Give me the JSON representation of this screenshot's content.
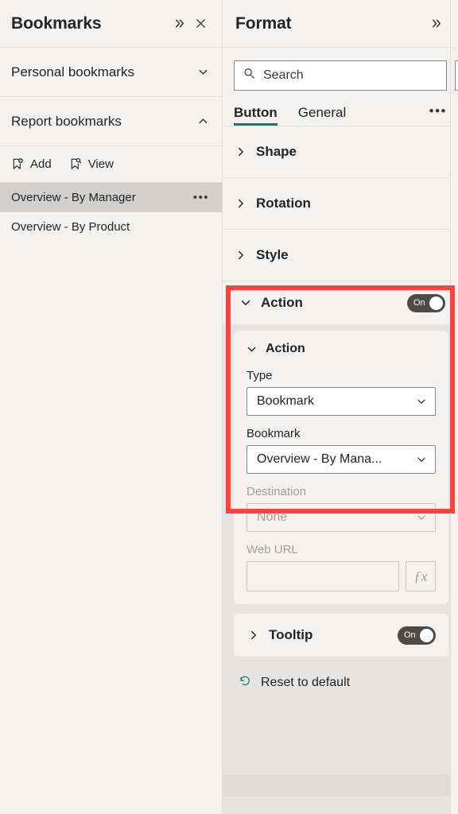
{
  "bookmarks_pane": {
    "title": "Bookmarks",
    "expand_icon": "double-chevron-right-icon",
    "close_icon": "close-icon",
    "sections": [
      {
        "label": "Personal bookmarks",
        "state": "collapsed",
        "chevron": "chevron-down-icon"
      },
      {
        "label": "Report bookmarks",
        "state": "expanded",
        "chevron": "chevron-up-icon"
      }
    ],
    "toolbar": [
      {
        "label": "Add",
        "icon": "bookmark-add-icon"
      },
      {
        "label": "View",
        "icon": "bookmark-view-icon"
      }
    ],
    "list": [
      {
        "label": "Overview - By Manager",
        "selected": true,
        "overflow": "•••"
      },
      {
        "label": "Overview - By Product",
        "selected": false,
        "overflow": ""
      }
    ]
  },
  "format_pane": {
    "title": "Format",
    "expand_icon": "double-chevron-right-icon",
    "search": {
      "placeholder": "Search",
      "value": "",
      "icon": "search-icon"
    },
    "tabs": [
      {
        "label": "Button",
        "active": true
      },
      {
        "label": "General",
        "active": false
      }
    ],
    "tabs_overflow": "•••",
    "accordions": [
      {
        "label": "Shape",
        "state": "collapsed"
      },
      {
        "label": "Rotation",
        "state": "collapsed"
      },
      {
        "label": "Style",
        "state": "collapsed"
      }
    ],
    "action_section": {
      "label": "Action",
      "state": "expanded",
      "toggle": {
        "text": "On",
        "on": true
      },
      "subcard": {
        "label": "Action",
        "state": "expanded",
        "fields": [
          {
            "label": "Type",
            "control": "dropdown",
            "value": "Bookmark",
            "disabled": false
          },
          {
            "label": "Bookmark",
            "control": "dropdown",
            "value": "Overview - By Mana...",
            "disabled": false
          },
          {
            "label": "Destination",
            "control": "dropdown",
            "value": "None",
            "disabled": true
          },
          {
            "label": "Web URL",
            "control": "textbox-with-fx",
            "value": "",
            "fx_label": "ƒx",
            "disabled": true
          }
        ]
      }
    },
    "tooltip_section": {
      "label": "Tooltip",
      "state": "collapsed",
      "toggle": {
        "text": "On",
        "on": true
      }
    },
    "reset": {
      "label": "Reset to default",
      "icon": "reset-undo-icon"
    }
  },
  "highlight": {
    "color": "#f8443c",
    "target": "action-section"
  },
  "theme": {
    "panel_bg": "#f3f2f1",
    "scroll_bg": "#e6e4e2",
    "accent_teal": "#0f7b6c",
    "selected_row": "#d2d0ce",
    "toggle_on": "#4d4b49",
    "border": "#e1dfdd"
  }
}
